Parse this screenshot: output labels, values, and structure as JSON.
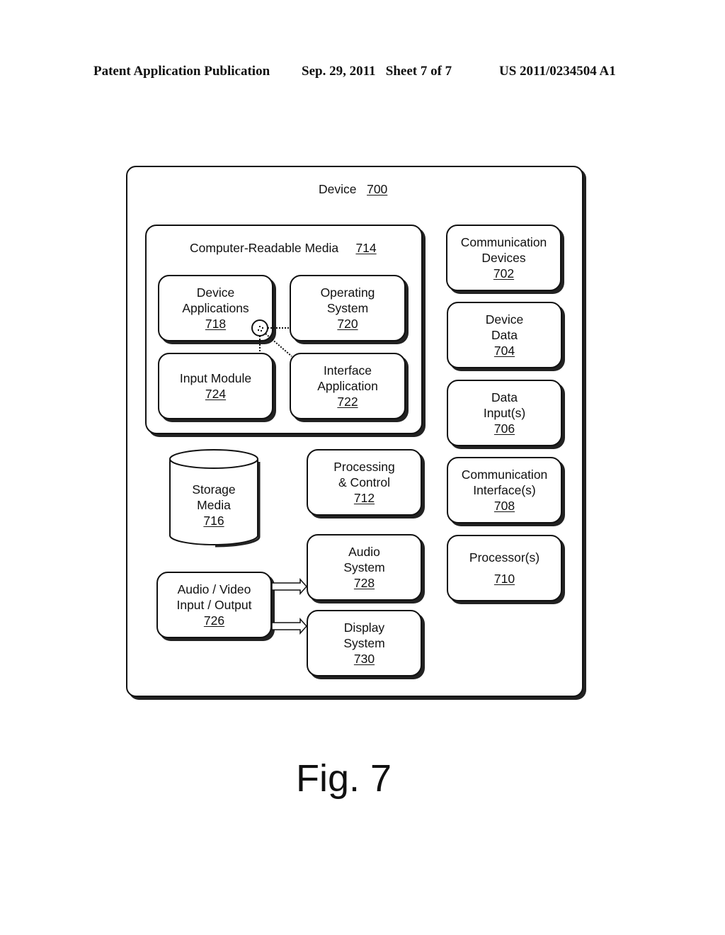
{
  "header": {
    "left": "Patent Application Publication",
    "middle": "Sep. 29, 2011   Sheet 7 of 7",
    "right": "US 2011/0234504 A1"
  },
  "device": {
    "label": "Device",
    "ref": "700"
  },
  "media": {
    "label": "Computer-Readable Media",
    "ref": "714",
    "device_applications": {
      "line1": "Device",
      "line2": "Applications",
      "ref": "718"
    },
    "operating_system": {
      "line1": "Operating",
      "line2": "System",
      "ref": "720"
    },
    "input_module": {
      "line1": "Input Module",
      "ref": "724"
    },
    "interface_application": {
      "line1": "Interface",
      "line2": "Application",
      "ref": "722"
    }
  },
  "storage_media": {
    "line1": "Storage",
    "line2": "Media",
    "ref": "716"
  },
  "processing_control": {
    "line1": "Processing",
    "line2": "& Control",
    "ref": "712"
  },
  "audio_system": {
    "line1": "Audio",
    "line2": "System",
    "ref": "728"
  },
  "display_system": {
    "line1": "Display",
    "line2": "System",
    "ref": "730"
  },
  "av_io": {
    "line1": "Audio / Video",
    "line2": "Input / Output",
    "ref": "726"
  },
  "communication_devices": {
    "line1": "Communication",
    "line2": "Devices",
    "ref": "702"
  },
  "device_data": {
    "line1": "Device",
    "line2": "Data",
    "ref": "704"
  },
  "data_inputs": {
    "line1": "Data",
    "line2": "Input(s)",
    "ref": "706"
  },
  "communication_interfaces": {
    "line1": "Communication",
    "line2": "Interface(s)",
    "ref": "708"
  },
  "processors": {
    "line1": "Processor(s)",
    "ref": "710"
  },
  "figure_caption": "Fig. 7"
}
